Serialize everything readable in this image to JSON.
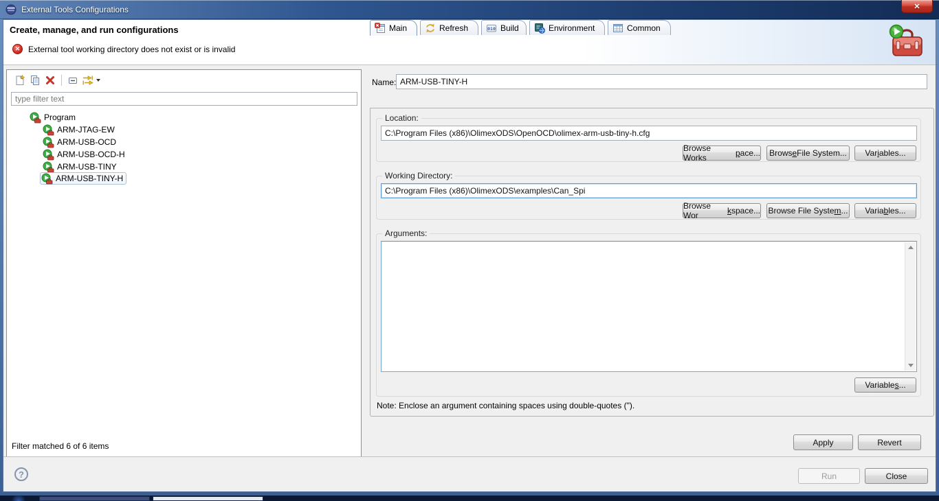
{
  "window": {
    "title": "External Tools Configurations",
    "close_glyph": "✕"
  },
  "header": {
    "title": "Create, manage, and run configurations",
    "error_glyph": "✕",
    "error": "External tool working directory does not exist or is invalid"
  },
  "left": {
    "filter_placeholder": "type filter text",
    "tree": {
      "root": "Program",
      "items": [
        "ARM-JTAG-EW",
        "ARM-USB-OCD",
        "ARM-USB-OCD-H",
        "ARM-USB-TINY",
        "ARM-USB-TINY-H"
      ],
      "selected": "ARM-USB-TINY-H"
    },
    "status": "Filter matched 6 of 6 items"
  },
  "form": {
    "name_label": "Name:",
    "name_value": "ARM-USB-TINY-H",
    "tabs": [
      "Main",
      "Refresh",
      "Build",
      "Environment",
      "Common"
    ],
    "location": {
      "label": "Location:",
      "value": "C:\\Program Files (x86)\\OlimexODS\\OpenOCD\\olimex-arm-usb-tiny-h.cfg",
      "buttons": [
        {
          "pre": "Browse Works",
          "u": "p",
          "post": "ace..."
        },
        {
          "pre": "Brows",
          "u": "e",
          "post": " File System..."
        },
        {
          "pre": "Var",
          "u": "i",
          "post": "ables..."
        }
      ]
    },
    "workdir": {
      "label": "Working Directory:",
      "value": "C:\\Program Files (x86)\\OlimexODS\\examples\\Can_Spi",
      "buttons": [
        {
          "pre": "Browse Wor",
          "u": "k",
          "post": "space..."
        },
        {
          "pre": "Browse File Syste",
          "u": "m",
          "post": "..."
        },
        {
          "pre": "Varia",
          "u": "b",
          "post": "les..."
        }
      ]
    },
    "arguments": {
      "label": "Arguments:",
      "value": "",
      "variables_button": {
        "pre": "Variable",
        "u": "s",
        "post": "..."
      }
    },
    "note": "Note: Enclose an argument containing spaces using double-quotes (\").",
    "apply": "Apply",
    "revert": "Revert"
  },
  "footer": {
    "help_glyph": "?",
    "run": "Run",
    "close": "Close"
  },
  "icons": {
    "build_text": "010"
  },
  "colors": {
    "titlebar_blue": "#1b3a6c",
    "error_red": "#cf2317",
    "focus_blue": "#5e9bd3",
    "toolbox_red": "#c94438",
    "play_green": "#3fae49"
  }
}
